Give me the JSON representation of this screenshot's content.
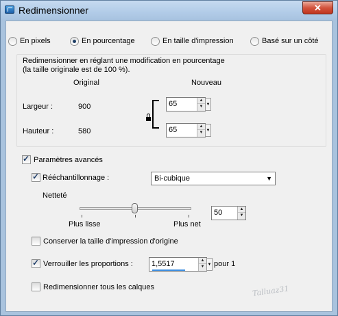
{
  "window": {
    "title": "Redimensionner",
    "close_label": "✕"
  },
  "modes": [
    {
      "label": "En pixels",
      "selected": false
    },
    {
      "label": "En pourcentage",
      "selected": true
    },
    {
      "label": "En taille d'impression",
      "selected": false
    },
    {
      "label": "Basé sur un côté",
      "selected": false
    }
  ],
  "percent_group": {
    "description_line1": "Redimensionner en réglant une modification en pourcentage",
    "description_line2": "(la taille originale est de 100 %).",
    "col_original": "Original",
    "col_new": "Nouveau",
    "width_label": "Largeur :",
    "width_original": "900",
    "width_new": "65",
    "height_label": "Hauteur :",
    "height_original": "580",
    "height_new": "65"
  },
  "advanced": {
    "label": "Paramètres avancés",
    "checked": true,
    "resample_label": "Rééchantillonnage :",
    "resample_checked": true,
    "resample_value": "Bi-cubique",
    "sharpness_label": "Netteté",
    "sharpness_value": "50",
    "sharpness_level": 0.5,
    "smoother_label": "Plus lisse",
    "sharper_label": "Plus net",
    "keep_print_size_label": "Conserver la taille d'impression d'origine",
    "keep_print_size_checked": false,
    "lock_ratio_label": "Verrouiller les proportions :",
    "lock_ratio_checked": true,
    "ratio_value": "1,5517",
    "ratio_suffix": "pour 1",
    "resize_layers_label": "Redimensionner tous les calques",
    "resize_layers_checked": false
  },
  "watermark": "Talluaz31"
}
